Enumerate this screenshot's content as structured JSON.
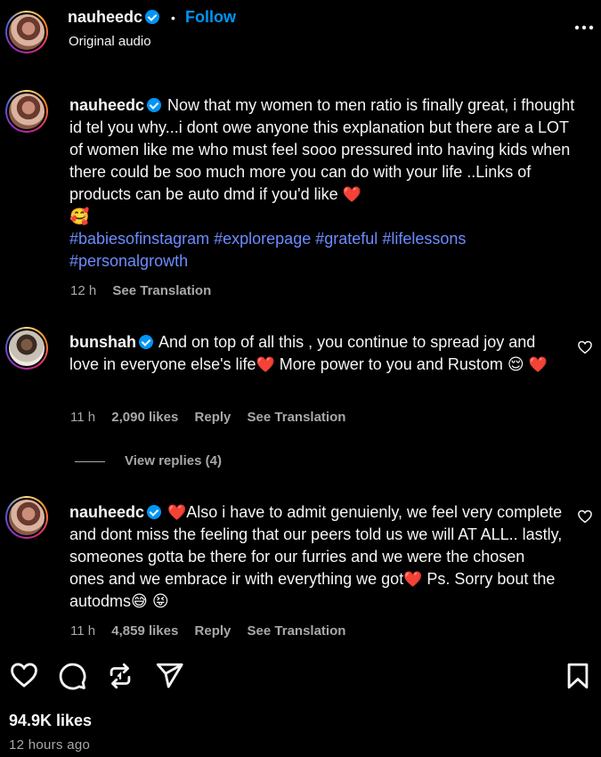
{
  "header": {
    "username": "nauheedc",
    "separator": "•",
    "follow_label": "Follow",
    "subtitle": "Original audio",
    "more_label": "•••"
  },
  "caption": {
    "username": "nauheedc",
    "text": "Now that my women to men ratio is finally great, i fhought id tel you why...i dont owe anyone this explanation but there are a LOT of women like me who must feel sooo pressured into having kids when there could be soo much more you can do with your life ..Links of products can be auto dmd if you'd like",
    "emoji_end": "❤️",
    "emoji_line": "🥰",
    "hashtags": [
      "#babiesofinstagram",
      "#explorepage",
      "#grateful",
      "#lifelessons",
      "#personalgrowth"
    ],
    "time": "12 h",
    "see_translation": "See Translation"
  },
  "comments": [
    {
      "username": "bunshah",
      "text_part1": "And on top of all this , you continue to spread joy and love in everyone else's life",
      "text_part2": " More power to you and Rustom ",
      "emoji_a": "❤️",
      "emoji_b": "😌",
      "emoji_c": "❤️",
      "time": "11 h",
      "likes": "2,090 likes",
      "reply": "Reply",
      "see_translation": "See Translation",
      "view_replies": "View replies (4)"
    },
    {
      "username": "nauheedc",
      "text_part1": "Also i have to admit genuienly, we feel very complete and dont miss the feeling that our peers told us we will AT ALL.. lastly, someones gotta be there for our furries and we were the chosen ones and we embrace ir with everything we got",
      "text_part2": " Ps. Sorry bout the autodms",
      "emoji_a": "❤️",
      "emoji_b": "❤️",
      "emoji_c": "😅",
      "emoji_d": "😝",
      "time": "11 h",
      "likes": "4,859 likes",
      "reply": "Reply",
      "see_translation": "See Translation"
    }
  ],
  "footer": {
    "likes": "94.9K likes",
    "time_ago": "12 hours ago"
  },
  "colors": {
    "background": "#000000",
    "text": "#f5f5f5",
    "muted": "#a8a8a8",
    "link": "#6c8cff",
    "verified": "#0095f6"
  }
}
